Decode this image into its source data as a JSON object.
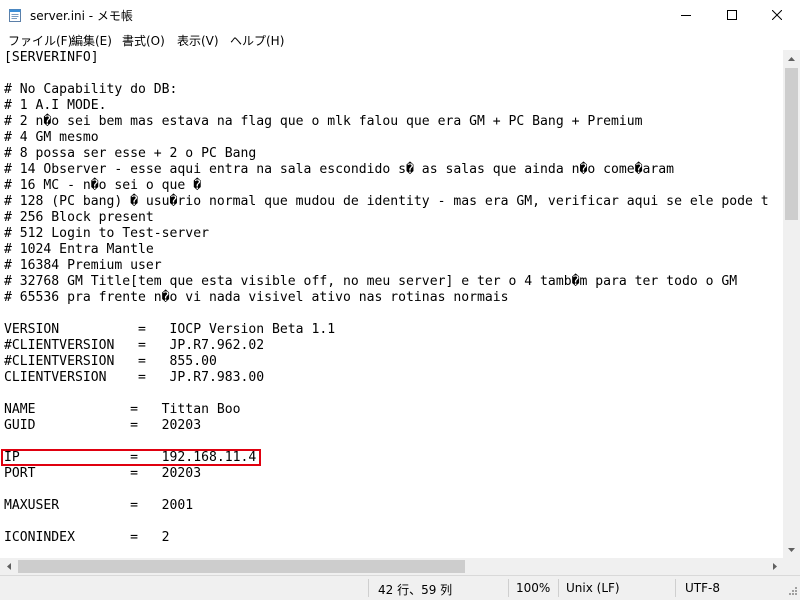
{
  "window": {
    "title": "server.ini - メモ帳",
    "app_icon": "notepad-icon",
    "controls": {
      "minimize": "minimize-icon",
      "maximize": "maximize-icon",
      "close": "close-icon"
    }
  },
  "menu": {
    "items": [
      "ファイル(F)",
      "編集(E)",
      "書式(O)",
      "表示(V)",
      "ヘルプ(H)"
    ]
  },
  "editor": {
    "lines": [
      "[SERVERINFO]",
      "",
      "# No Capability do DB:",
      "# 1 A.I MODE.",
      "# 2 n�o sei bem mas estava na flag que o mlk falou que era GM + PC Bang + Premium",
      "# 4 GM mesmo",
      "# 8 possa ser esse + 2 o PC Bang",
      "# 14 Observer - esse aqui entra na sala escondido s� as salas que ainda n�o come�aram",
      "# 16 MC - n�o sei o que �",
      "# 128 (PC bang) � usu�rio normal que mudou de identity - mas era GM, verificar aqui se ele pode t",
      "# 256 Block present",
      "# 512 Login to Test-server",
      "# 1024 Entra Mantle",
      "# 16384 Premium user",
      "# 32768 GM Title[tem que esta visible off, no meu server] e ter o 4 tamb�m para ter todo o GM",
      "# 65536 pra frente n�o vi nada visivel ativo nas rotinas normais",
      "",
      "VERSION          =   IOCP Version Beta 1.1",
      "#CLIENTVERSION   =   JP.R7.962.02",
      "#CLIENTVERSION   =   855.00",
      "CLIENTVERSION    =   JP.R7.983.00",
      "",
      "NAME            =   Tittan Boo",
      "GUID            =   20203",
      "",
      "IP              =   192.168.11.4",
      "PORT            =   20203",
      "",
      "MAXUSER         =   2001",
      "",
      "ICONINDEX       =   2"
    ]
  },
  "status": {
    "position": "42 行、59 列",
    "zoom": "100%",
    "line_ending": "Unix (LF)",
    "encoding": "UTF-8"
  },
  "colors": {
    "highlight": "#e0000f",
    "scrollbar_track": "#f0f0f0",
    "scrollbar_thumb": "#cdcdcd",
    "statusbar": "#f0f0f0"
  }
}
